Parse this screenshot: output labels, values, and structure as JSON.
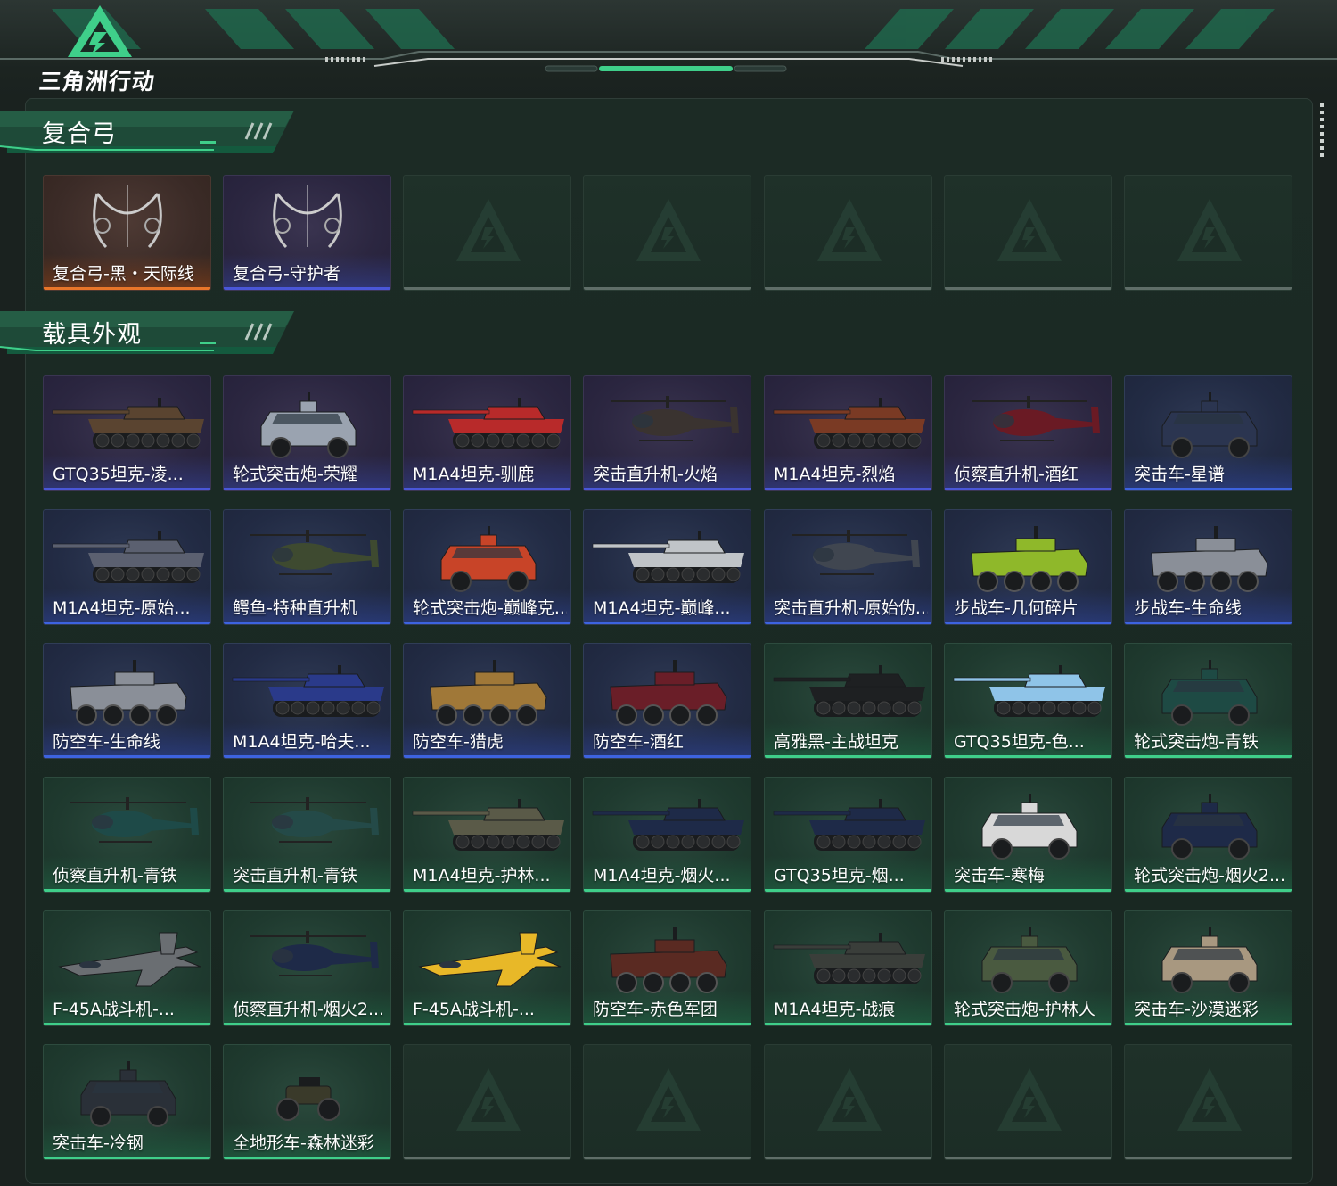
{
  "app": {
    "logo_text": "三角洲行动",
    "accent_color": "#3fcf8a"
  },
  "sections": [
    {
      "title": "复合弓",
      "items": [
        {
          "label": "复合弓-黑・天际线",
          "rarity": "orange",
          "icon": "compound-bow-icon"
        },
        {
          "label": "复合弓-守护者",
          "rarity": "purple",
          "icon": "compound-bow-icon"
        },
        {
          "label": "",
          "rarity": "empty"
        },
        {
          "label": "",
          "rarity": "empty"
        },
        {
          "label": "",
          "rarity": "empty"
        },
        {
          "label": "",
          "rarity": "empty"
        },
        {
          "label": "",
          "rarity": "empty"
        }
      ]
    },
    {
      "title": "载具外观",
      "items": [
        {
          "label": "GTQ35坦克-凌...",
          "rarity": "purple",
          "icon": "tank-icon",
          "color": "#5a4430"
        },
        {
          "label": "轮式突击炮-荣耀",
          "rarity": "purple",
          "icon": "armored-car-icon",
          "color": "#9aa3b0"
        },
        {
          "label": "M1A4坦克-驯鹿",
          "rarity": "purple",
          "icon": "tank-icon",
          "color": "#b82a2a"
        },
        {
          "label": "突击直升机-火焰",
          "rarity": "purple",
          "icon": "helicopter-icon",
          "color": "#3a3330"
        },
        {
          "label": "M1A4坦克-烈焰",
          "rarity": "purple",
          "icon": "tank-icon",
          "color": "#7a3a24"
        },
        {
          "label": "侦察直升机-酒红",
          "rarity": "purple",
          "icon": "helicopter-icon",
          "color": "#6a1a24"
        },
        {
          "label": "突击车-星谱",
          "rarity": "blue",
          "icon": "armored-car-icon",
          "color": "#2b3550"
        },
        {
          "label": "M1A4坦克-原始...",
          "rarity": "blue",
          "icon": "tank-icon",
          "color": "#5b6070"
        },
        {
          "label": "鳄鱼-特种直升机",
          "rarity": "blue",
          "icon": "helicopter-icon",
          "color": "#3e4a30"
        },
        {
          "label": "轮式突击炮-巅峰克...",
          "rarity": "blue",
          "icon": "armored-car-icon",
          "color": "#c84428"
        },
        {
          "label": "M1A4坦克-巅峰...",
          "rarity": "blue",
          "icon": "tank-icon",
          "color": "#c0c4c8"
        },
        {
          "label": "突击直升机-原始伪...",
          "rarity": "blue",
          "icon": "helicopter-icon",
          "color": "#404650"
        },
        {
          "label": "步战车-几何碎片",
          "rarity": "blue",
          "icon": "apc-icon",
          "color": "#8fb82a"
        },
        {
          "label": "步战车-生命线",
          "rarity": "blue",
          "icon": "apc-icon",
          "color": "#8a8f98"
        },
        {
          "label": "防空车-生命线",
          "rarity": "blue",
          "icon": "apc-icon",
          "color": "#8a8f98"
        },
        {
          "label": "M1A4坦克-哈夫...",
          "rarity": "blue",
          "icon": "tank-icon",
          "color": "#2a3a8a"
        },
        {
          "label": "防空车-猎虎",
          "rarity": "blue",
          "icon": "apc-icon",
          "color": "#a07838"
        },
        {
          "label": "防空车-酒红",
          "rarity": "blue",
          "icon": "apc-icon",
          "color": "#6a1e28"
        },
        {
          "label": "高雅黑-主战坦克",
          "rarity": "green",
          "icon": "tank-icon",
          "color": "#1e2022"
        },
        {
          "label": "GTQ35坦克-色...",
          "rarity": "green",
          "icon": "tank-icon",
          "color": "#8fc4e8"
        },
        {
          "label": "轮式突击炮-青铁",
          "rarity": "green",
          "icon": "armored-car-icon",
          "color": "#1e4a44"
        },
        {
          "label": "侦察直升机-青铁",
          "rarity": "green",
          "icon": "helicopter-icon",
          "color": "#1e4a48"
        },
        {
          "label": "突击直升机-青铁",
          "rarity": "green",
          "icon": "helicopter-icon",
          "color": "#244a48"
        },
        {
          "label": "M1A4坦克-护林...",
          "rarity": "green",
          "icon": "tank-icon",
          "color": "#5a5a48"
        },
        {
          "label": "M1A4坦克-烟火...",
          "rarity": "green",
          "icon": "tank-icon",
          "color": "#1e2a48"
        },
        {
          "label": "GTQ35坦克-烟...",
          "rarity": "green",
          "icon": "tank-icon",
          "color": "#1e2a48"
        },
        {
          "label": "突击车-寒梅",
          "rarity": "green",
          "icon": "armored-car-icon",
          "color": "#d8d8d8"
        },
        {
          "label": "轮式突击炮-烟火2...",
          "rarity": "green",
          "icon": "armored-car-icon",
          "color": "#1e2a48"
        },
        {
          "label": "F-45A战斗机-...",
          "rarity": "green",
          "icon": "fighter-jet-icon",
          "color": "#6a6e72"
        },
        {
          "label": "侦察直升机-烟火2...",
          "rarity": "green",
          "icon": "helicopter-icon",
          "color": "#1e2a48"
        },
        {
          "label": "F-45A战斗机-...",
          "rarity": "green",
          "icon": "fighter-jet-icon",
          "color": "#e8b828"
        },
        {
          "label": "防空车-赤色军团",
          "rarity": "green",
          "icon": "apc-icon",
          "color": "#5a2a22"
        },
        {
          "label": "M1A4坦克-战痕",
          "rarity": "green",
          "icon": "tank-icon",
          "color": "#3a3e3a"
        },
        {
          "label": "轮式突击炮-护林人",
          "rarity": "green",
          "icon": "armored-car-icon",
          "color": "#4a5a40"
        },
        {
          "label": "突击车-沙漠迷彩",
          "rarity": "green",
          "icon": "armored-car-icon",
          "color": "#a89880"
        },
        {
          "label": "突击车-冷钢",
          "rarity": "green",
          "icon": "armored-car-icon",
          "color": "#2a3038"
        },
        {
          "label": "全地形车-森林迷彩",
          "rarity": "green",
          "icon": "atv-icon",
          "color": "#3a3a2a"
        },
        {
          "label": "",
          "rarity": "empty"
        },
        {
          "label": "",
          "rarity": "empty"
        },
        {
          "label": "",
          "rarity": "empty"
        },
        {
          "label": "",
          "rarity": "empty"
        },
        {
          "label": "",
          "rarity": "empty"
        }
      ]
    }
  ]
}
